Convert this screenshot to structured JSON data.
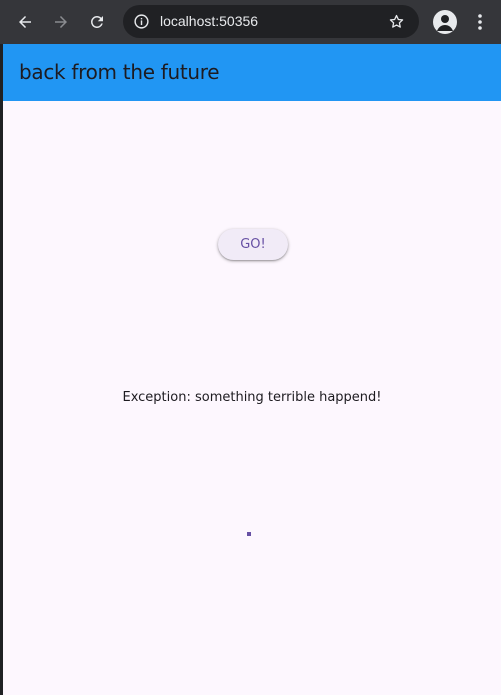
{
  "browser": {
    "url": "localhost:50356",
    "back_icon": "arrow-left-icon",
    "forward_icon": "arrow-right-icon",
    "reload_icon": "reload-icon",
    "site_info_icon": "info-icon",
    "bookmark_icon": "star-icon",
    "profile_icon": "profile-icon",
    "menu_icon": "more-vert-icon"
  },
  "app_bar": {
    "title": "back from the future",
    "color": "#2196f3"
  },
  "main": {
    "go_button_label": "GO!",
    "error_message": "Exception: something terrible happend!",
    "accent_color": "#6750a4",
    "background_color": "#fdf7fe"
  }
}
